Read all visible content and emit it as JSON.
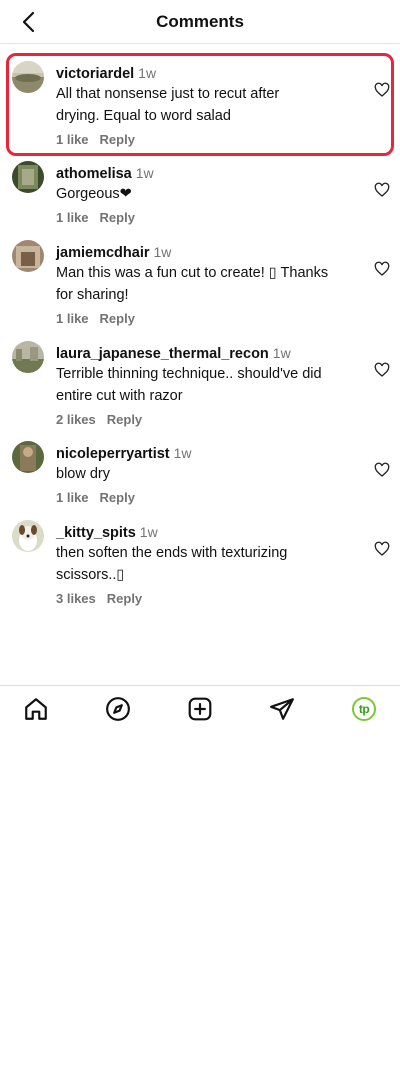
{
  "header": {
    "title": "Comments",
    "back_icon": "chevron-left-icon"
  },
  "comments": [
    {
      "username": "victoriardel",
      "time": "1w",
      "lines": [
        "All that nonsense just to recut after",
        "drying. Equal to word salad"
      ],
      "likes": "1 like",
      "reply": "Reply",
      "highlighted": true
    },
    {
      "username": "athomelisa",
      "time": "1w",
      "lines": [
        "Gorgeous❤"
      ],
      "likes": "1 like",
      "reply": "Reply"
    },
    {
      "username": "jamiemcdhair",
      "time": "1w",
      "lines": [
        "Man this was a fun cut to create! ▯ Thanks",
        "for sharing!"
      ],
      "likes": "1 like",
      "reply": "Reply"
    },
    {
      "username": "laura_japanese_thermal_recon",
      "time": "1w",
      "lines": [
        "Terrible thinning technique.. should've did",
        "entire cut with razor"
      ],
      "likes": "2 likes",
      "reply": "Reply"
    },
    {
      "username": "nicoleperryartist",
      "time": "1w",
      "lines": [
        "blow dry"
      ],
      "likes": "1 like",
      "reply": "Reply"
    },
    {
      "username": "_kitty_spits",
      "time": "1w",
      "lines": [
        "then soften the ends with texturizing",
        "scissors..▯"
      ],
      "likes": "3 likes",
      "reply": "Reply"
    }
  ],
  "tabbar": {
    "items": [
      "home-icon",
      "explore-compass-icon",
      "create-plus-icon",
      "direct-send-icon",
      "profile-tp-icon"
    ],
    "profile_label": "tp"
  },
  "colors": {
    "highlight": "#e8253a",
    "secondary_text": "#737373",
    "profile_ring": "#7dc733"
  }
}
